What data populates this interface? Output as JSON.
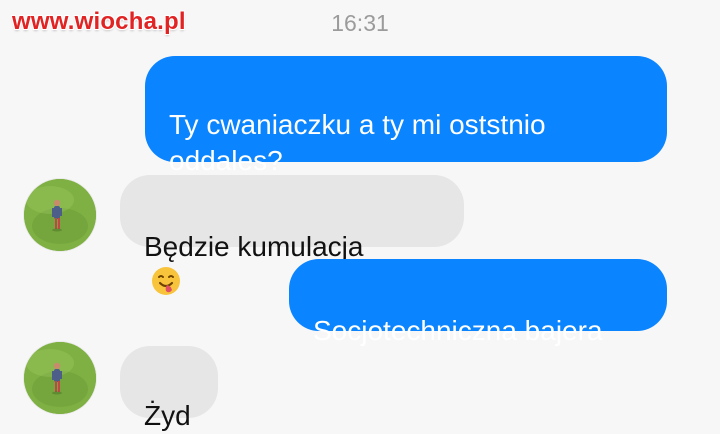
{
  "watermark": {
    "text": "www.wiocha.pl"
  },
  "chat": {
    "timestamp": "16:31",
    "messages": [
      {
        "type": "outgoing",
        "text": "Ty cwaniaczku a ty mi oststnio\noddales?"
      },
      {
        "type": "incoming",
        "text": "Będzie kumulacja",
        "emoji": "tongue-wink-emoji-icon"
      },
      {
        "type": "outgoing",
        "text": "Socjotechniczna bajera"
      },
      {
        "type": "incoming",
        "text": "Żyd"
      }
    ]
  },
  "avatar": {
    "icon": "contact-avatar-icon"
  },
  "colors": {
    "background": "#f7f7f7",
    "outgoing_bubble": "#0a84ff",
    "incoming_bubble": "#e6e6e6",
    "outgoing_text": "#ffffff",
    "incoming_text": "#111111",
    "timestamp_text": "#9b9b9b",
    "watermark_text": "#e12323"
  }
}
